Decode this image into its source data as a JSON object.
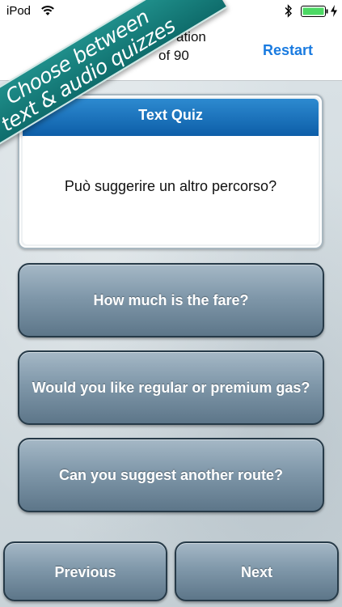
{
  "status_bar": {
    "device": "iPod"
  },
  "nav": {
    "title_partial": "ation",
    "progress_partial": "of 90",
    "restart_label": "Restart"
  },
  "promo": {
    "line1": "Choose between",
    "line2": "text & audio quizzes"
  },
  "quiz": {
    "header": "Text Quiz",
    "question": "Può suggerire un altro percorso?"
  },
  "answers": [
    {
      "label": "How much is the fare?"
    },
    {
      "label": "Would you like regular or premium gas?"
    },
    {
      "label": "Can you suggest another route?"
    }
  ],
  "footer": {
    "previous_label": "Previous",
    "next_label": "Next"
  },
  "colors": {
    "accent": "#1a7be0",
    "banner": "#1f8e8a",
    "card_header": "#0d5ea8",
    "button": "#8098aa"
  },
  "icons": {
    "status": [
      "wifi-icon",
      "bluetooth-icon",
      "battery-icon",
      "charging-icon"
    ]
  }
}
